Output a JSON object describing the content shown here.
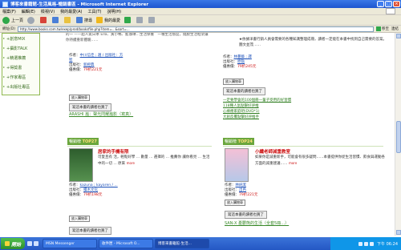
{
  "window": {
    "title": "博客來書籍館-生活風格-暢銷書區 - Microsoft Internet Explorer"
  },
  "menu": [
    "檔案(F)",
    "編輯(E)",
    "檢視(V)",
    "我的最愛(A)",
    "工具(T)",
    "說明(H)"
  ],
  "toolbar": {
    "back": "上一頁",
    "search": "搜尋",
    "favorites": "我的最愛"
  },
  "address": {
    "label": "網址(D)",
    "url": "http://www.books.com.tw/exep/prod/booksfile.php?item=...&sort=...",
    "go": "移至",
    "links": "連結"
  },
  "sidebar": [
    "+創意MIX",
    "+攝影TALK",
    "+精選推薦",
    "+得獎書",
    "+作家專區",
    "+出版社專區"
  ],
  "cards": {
    "top_left": {
      "desc_tail": "的一 ——超人氣日本 Ella、黃小鴨、藍珈琳…生活保養　一種生活態度，擺脫生活框架讓你持續重新體驗……",
      "author_label": "作者：",
      "author": "中川信佳 ; 趙 / 出版社：方智",
      "publisher_label": "出版社：",
      "publisher": "新經典",
      "price_label": "優惠價：",
      "price": "79折221元",
      "cart": "放入購物車",
      "book_btn": "寫這本書的讀者也買了",
      "link": "ARASHI 嵐：聲光閃耀嵐影（寫真）"
    },
    "top_right": {
      "desc": "★依據洋書行銷人員會需要的各種知識整理成冊，讀者一定能在本書中找到自己需要的答案。圖文並茂……",
      "author_label": "作者：",
      "author": "林蔓藝 ; 譯",
      "publisher_label": "出版社：",
      "publisher": "原點",
      "price_label": "優惠價：",
      "price": "79折245元",
      "cart": "放入購物車",
      "book_btn": "寫這本書的讀者也買了",
      "links": [
        "一定要學會的100個冊一輩子受用的好習慣",
        "118種人氣點擊好評推",
        "心療癒家庭吧(DVD*1)",
        "大創反覆點擊好評推手"
      ]
    },
    "bottom_left": {
      "rank_label": "暢銷榜",
      "rank": "TOP27",
      "title": "居家的手機有限",
      "desc": "可愛且有 活，輕鬆好學 ... 數量 ... 選擇的 ... 推薦你 讓你看見 ... 生活中的一切 ... 原來",
      "author_label": "作者：",
      "author": "kazuna ; kayaren / ...",
      "publisher_label": "出版社：",
      "publisher": "積木文化",
      "price_label": "優惠價：",
      "price": "79折198元",
      "cart": "放入購物車",
      "book_btn": "寫這本書的讀者也買了"
    },
    "bottom_right": {
      "rank_label": "暢銷榜",
      "rank": "TOP24",
      "title": "小纖老師減重教室",
      "desc": "如果你是減重新手，可能會有很多疑問……本書提供你從生活習慣、飲食與運動各方面的減重建議……",
      "author_label": "作者：",
      "author": "林純潔",
      "publisher_label": "出版社：",
      "publisher": "出色",
      "price_label": "優惠價：",
      "price": "79折221元",
      "cart": "放入購物車",
      "book_btn": "寫這本書的讀者也買了",
      "link": "SAN-X 憂鬱熊的生活（全套5冊…）"
    }
  },
  "taskbar": {
    "start": "開始",
    "tasks": [
      "MSN Messenger",
      "收件匣 - Microsoft O...",
      "博客來書籍館-生活..."
    ],
    "clock": "下午 06:24"
  },
  "colors": {
    "accent_green": "#6aa63c",
    "title_red": "#cc1111",
    "link_blue": "#1b4fb8"
  }
}
